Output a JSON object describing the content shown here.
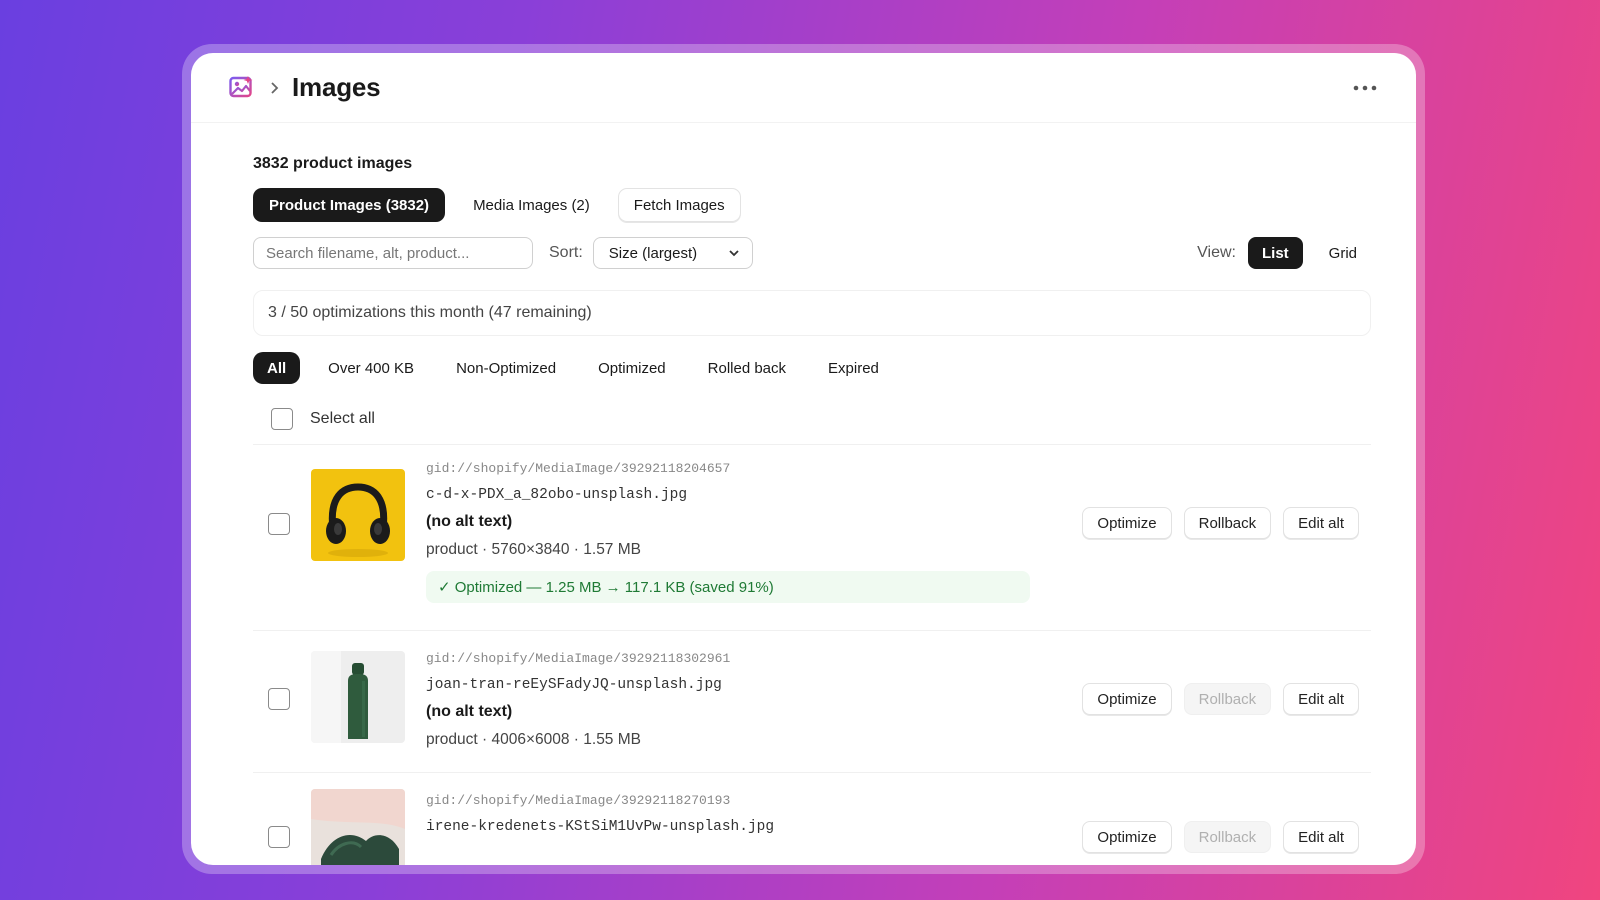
{
  "header": {
    "title": "Images"
  },
  "summary": {
    "count_heading": "3832 product images"
  },
  "tabs": [
    {
      "label": "Product Images (3832)",
      "active": true
    },
    {
      "label": "Media Images (2)",
      "active": false
    },
    {
      "label": "Fetch Images",
      "active": false
    }
  ],
  "toolbar": {
    "search_placeholder": "Search filename, alt, product...",
    "sort_label": "Sort:",
    "sort_value": "Size (largest)",
    "view_label": "View:",
    "view_list": "List",
    "view_grid": "Grid"
  },
  "quota": {
    "text": "3 / 50 optimizations this month (47 remaining)"
  },
  "filters": [
    {
      "label": "All",
      "active": true
    },
    {
      "label": "Over 400 KB",
      "active": false
    },
    {
      "label": "Non-Optimized",
      "active": false
    },
    {
      "label": "Optimized",
      "active": false
    },
    {
      "label": "Rolled back",
      "active": false
    },
    {
      "label": "Expired",
      "active": false
    }
  ],
  "select_all_label": "Select all",
  "rows": [
    {
      "gid": "gid://shopify/MediaImage/39292118204657",
      "filename": "c-d-x-PDX_a_82obo-unsplash.jpg",
      "alt": "(no alt text)",
      "info": "product · 5760×3840 · 1.57 MB",
      "optimized_text": "✓ Optimized — 1.25 MB → 117.1 KB (saved 91%)",
      "thumb_icon": "headphones-thumbnail",
      "rollback_enabled": true
    },
    {
      "gid": "gid://shopify/MediaImage/39292118302961",
      "filename": "joan-tran-reEySFadyJQ-unsplash.jpg",
      "alt": "(no alt text)",
      "info": "product · 4006×6008 · 1.55 MB",
      "thumb_icon": "bottle-thumbnail",
      "rollback_enabled": false
    },
    {
      "gid": "gid://shopify/MediaImage/39292118270193",
      "filename": "irene-kredenets-KStSiM1UvPw-unsplash.jpg",
      "thumb_icon": "shoes-thumbnail",
      "rollback_enabled": false
    }
  ],
  "actions": {
    "optimize": "Optimize",
    "rollback": "Rollback",
    "edit_alt": "Edit alt"
  },
  "colors": {
    "accent_dark": "#1a1a1a",
    "success_text": "#1f7a35",
    "success_bg": "#f0faf1"
  }
}
